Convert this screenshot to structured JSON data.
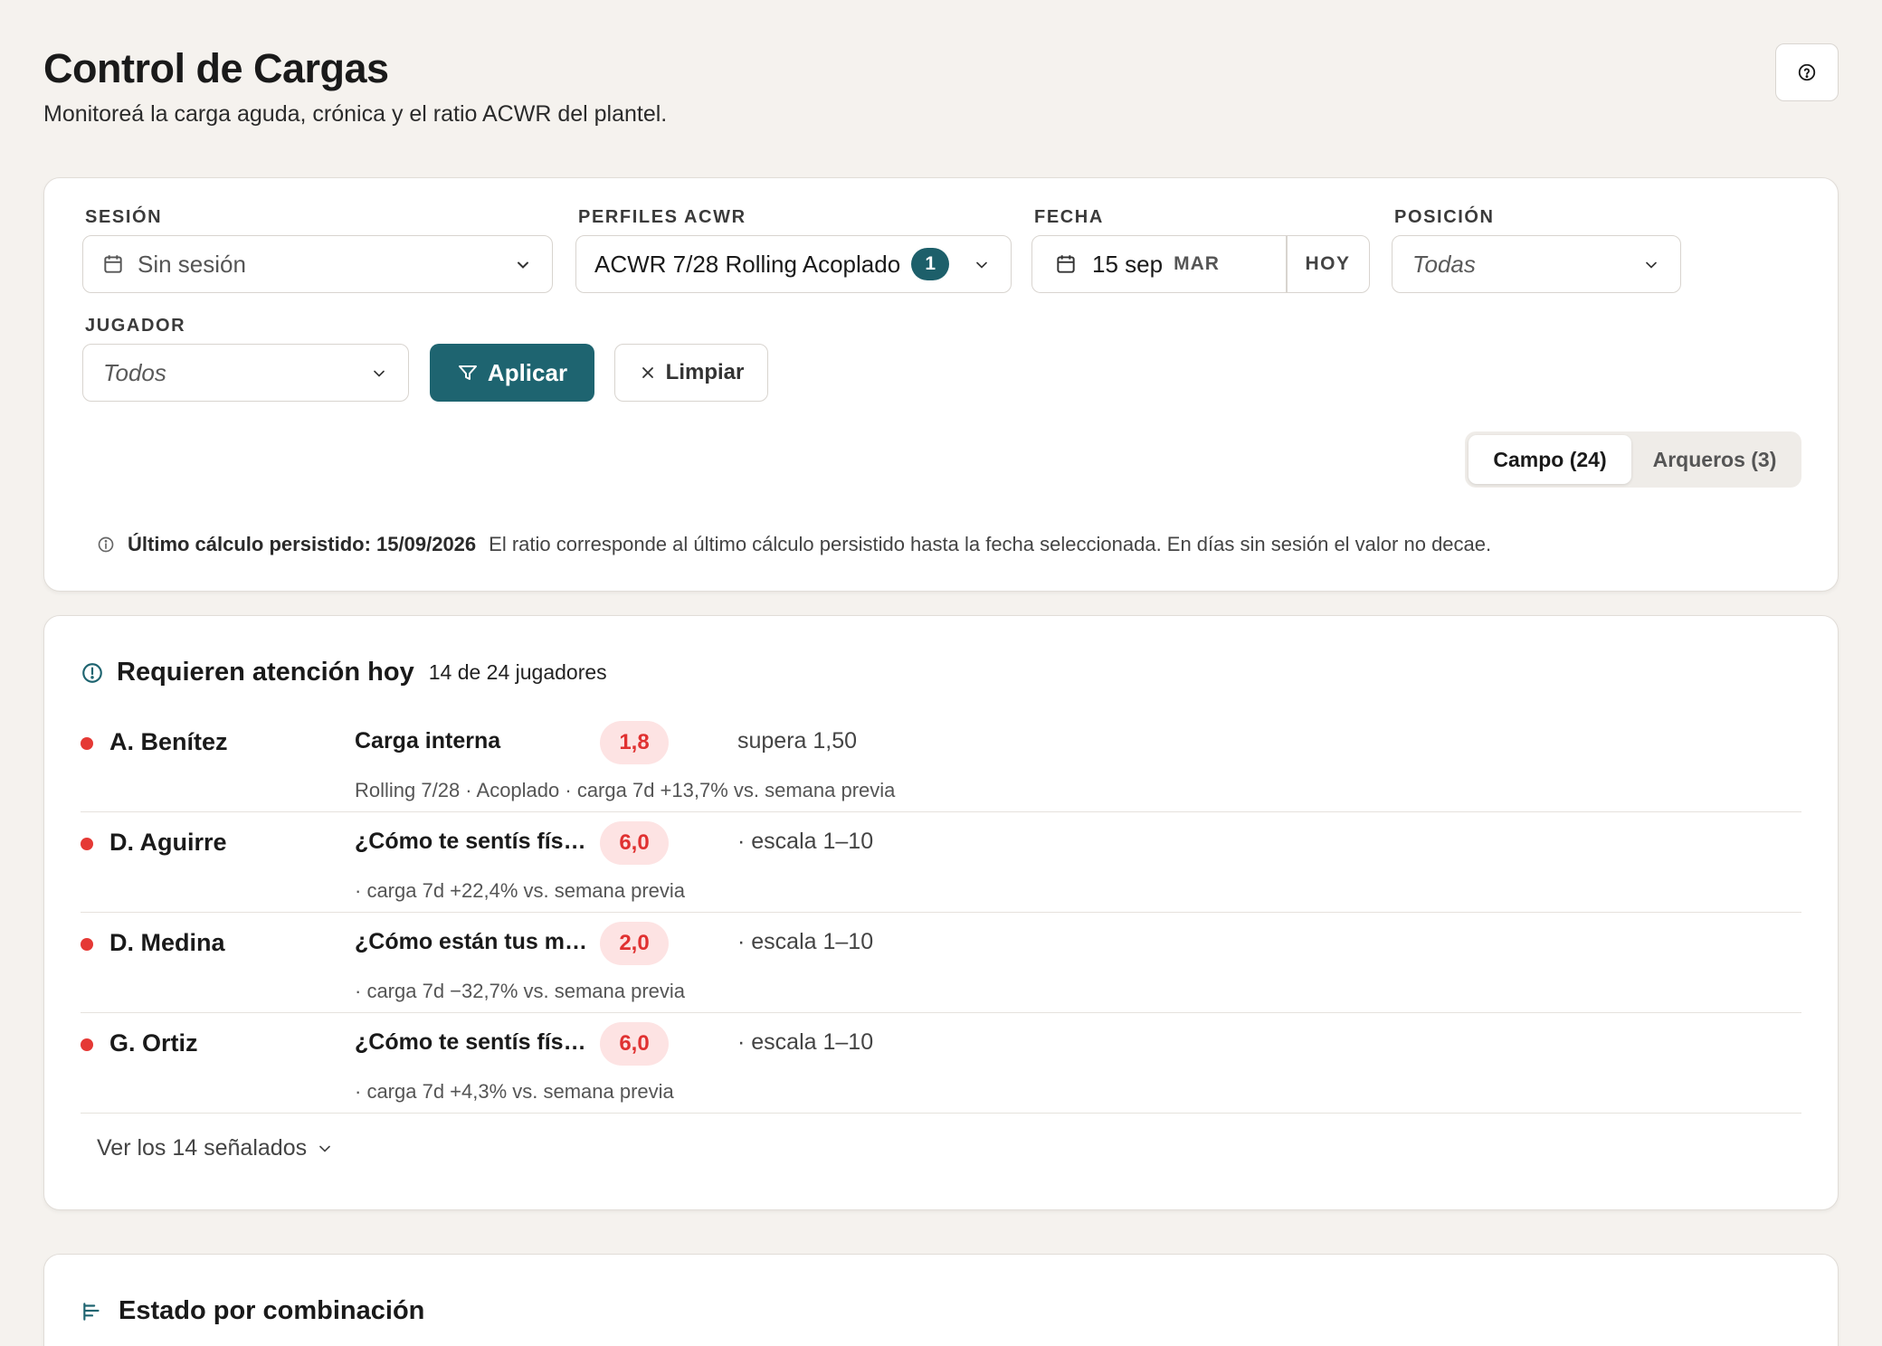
{
  "header": {
    "title": "Control de Cargas",
    "subtitle": "Monitoreá la carga aguda, crónica y el ratio ACWR del plantel."
  },
  "filters": {
    "session": {
      "label": "SESIÓN",
      "value": "Sin sesión"
    },
    "profiles": {
      "label": "PERFILES ACWR",
      "value": "ACWR 7/28 Rolling Acoplado",
      "count": "1"
    },
    "date": {
      "label": "FECHA",
      "value": "15 sep",
      "weekday": "MAR",
      "today": "HOY"
    },
    "position": {
      "label": "POSICIÓN",
      "value": "Todas"
    },
    "player": {
      "label": "JUGADOR",
      "value": "Todos"
    },
    "apply_label": "Aplicar",
    "clear_label": "Limpiar",
    "segments": [
      {
        "label": "Campo (24)",
        "active": true
      },
      {
        "label": "Arqueros (3)",
        "active": false
      }
    ],
    "info": {
      "bold": "Último cálculo persistido: 15/09/2026",
      "text": "El ratio corresponde al último cálculo persistido hasta la fecha seleccionada. En días sin sesión el valor no decae."
    }
  },
  "attention": {
    "title": "Requieren atención hoy",
    "count": "14 de 24 jugadores",
    "rows": [
      {
        "name": "A. Benítez",
        "metric": "Carga interna",
        "value": "1,8",
        "note": "supera 1,50",
        "sub": "Rolling 7/28 · Acoplado · carga 7d +13,7% vs. semana previa"
      },
      {
        "name": "D. Aguirre",
        "metric": "¿Cómo te sentís físicamente hoy?",
        "value": "6,0",
        "note": "· escala 1–10",
        "sub": "· carga 7d +22,4% vs. semana previa"
      },
      {
        "name": "D. Medina",
        "metric": "¿Cómo están tus músculos hoy?",
        "value": "2,0",
        "note": "· escala 1–10",
        "sub": "· carga 7d −32,7% vs. semana previa"
      },
      {
        "name": "G. Ortiz",
        "metric": "¿Cómo te sentís físicamente hoy?",
        "value": "6,0",
        "note": "· escala 1–10",
        "sub": "· carga 7d +4,3% vs. semana previa"
      }
    ],
    "see_more": "Ver los 14 señalados"
  },
  "state": {
    "title": "Estado por combinación"
  },
  "colors": {
    "accent": "#1e6470",
    "alert": "#e53935",
    "background": "#f5f2ee"
  },
  "icons": [
    "help-icon",
    "calendar-icon",
    "chevron-down-icon",
    "filter-icon",
    "close-icon",
    "info-icon",
    "alert-circle-icon",
    "list-icon"
  ]
}
